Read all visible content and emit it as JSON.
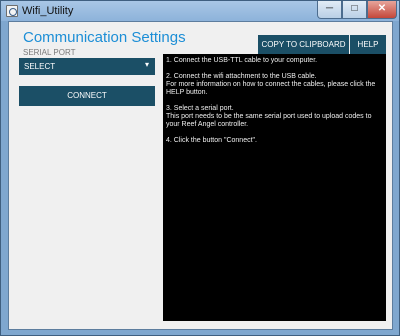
{
  "window": {
    "title": "Wifi_Utility",
    "controls": {
      "minimize": "─",
      "maximize": "□",
      "close": "✕"
    }
  },
  "panel": {
    "heading": "Communication Settings",
    "serial_port_label": "SERIAL PORT",
    "serial_port_value": "SELECT",
    "connect_label": "CONNECT"
  },
  "toolbar": {
    "copy_label": "COPY TO CLIPBOARD",
    "help_label": "HELP"
  },
  "console": {
    "lines": [
      "1. Connect the USB-TTL cable to your computer.",
      "2. Connect the wifi attachment to the USB cable.\nFor more information on how to connect the cables, please click the HELP button.",
      "3. Select a serial port.\nThis port needs to be the same serial port used to upload codes to your Reef Angel controller.",
      "4. Click the button \"Connect\"."
    ]
  },
  "colors": {
    "accent": "#1c8ed6",
    "button_bg": "#1b4f66",
    "console_bg": "#000000"
  },
  "icons": {
    "dropdown": "chevron-down-icon",
    "app": "app-icon"
  }
}
